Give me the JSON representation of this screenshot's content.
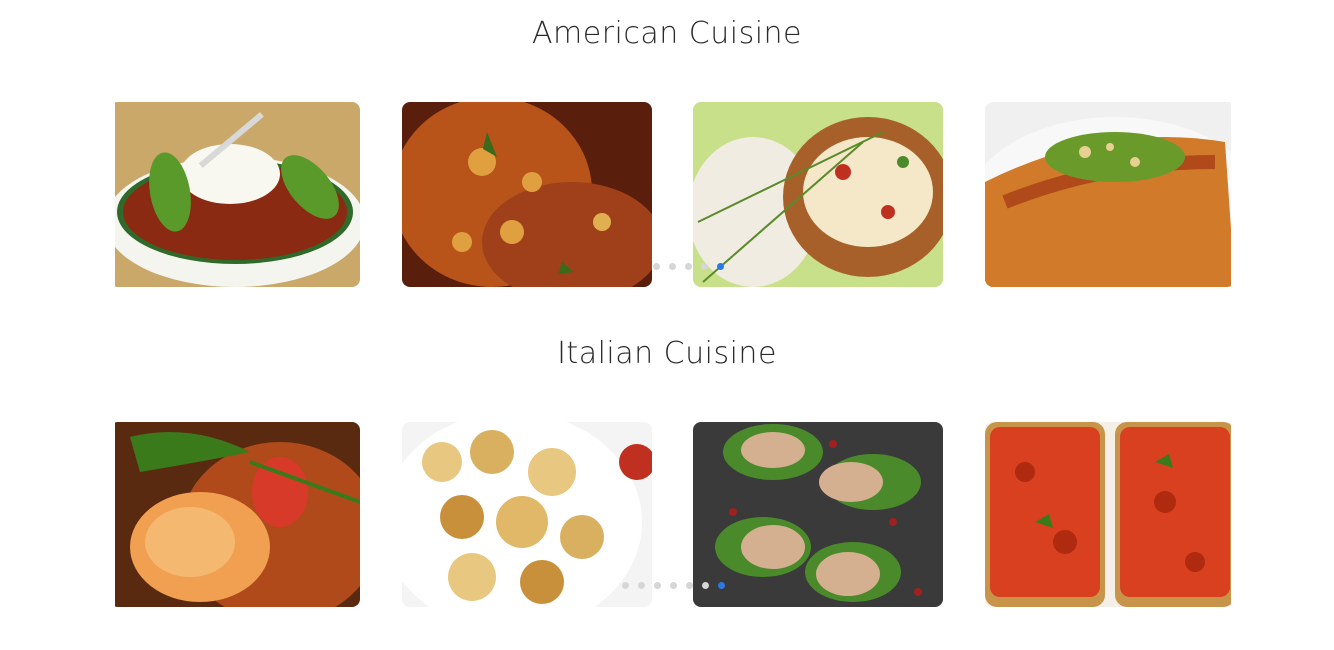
{
  "sections": [
    {
      "title": "American Cuisine",
      "dots_total": 5,
      "dots_active_index": 4,
      "cards": [
        {
          "name": "chili-bowl-image",
          "palette": [
            "#8a2a12",
            "#e8ead8",
            "#5a9a2a",
            "#f5f5f0"
          ]
        },
        {
          "name": "orzo-stew-image",
          "palette": [
            "#b8531a",
            "#6a2a10",
            "#e0a040",
            "#3a6a1a"
          ]
        },
        {
          "name": "cheesy-casserole-image",
          "palette": [
            "#c8e08a",
            "#f4f0e8",
            "#b06a3a",
            "#8a5a2a"
          ]
        },
        {
          "name": "glazed-salmon-image",
          "palette": [
            "#d07a2a",
            "#f0f0f0",
            "#6a9a2a",
            "#b04a1a"
          ]
        }
      ]
    },
    {
      "title": "Italian Cuisine",
      "dots_total": 7,
      "dots_active_index": 6,
      "cards": [
        {
          "name": "shrimp-dish-image",
          "palette": [
            "#b04a1a",
            "#f0a050",
            "#3a7a1a",
            "#5a2a10"
          ]
        },
        {
          "name": "fried-bites-image",
          "palette": [
            "#e8c880",
            "#c8903a",
            "#f4f4f4",
            "#3a6a1a"
          ]
        },
        {
          "name": "mushroom-toast-image",
          "palette": [
            "#3a3a3a",
            "#d4b090",
            "#4a8a2a",
            "#a02020"
          ]
        },
        {
          "name": "bruschetta-image",
          "palette": [
            "#d84020",
            "#c8944a",
            "#f4f0e8",
            "#3a7a1a"
          ]
        }
      ]
    }
  ]
}
